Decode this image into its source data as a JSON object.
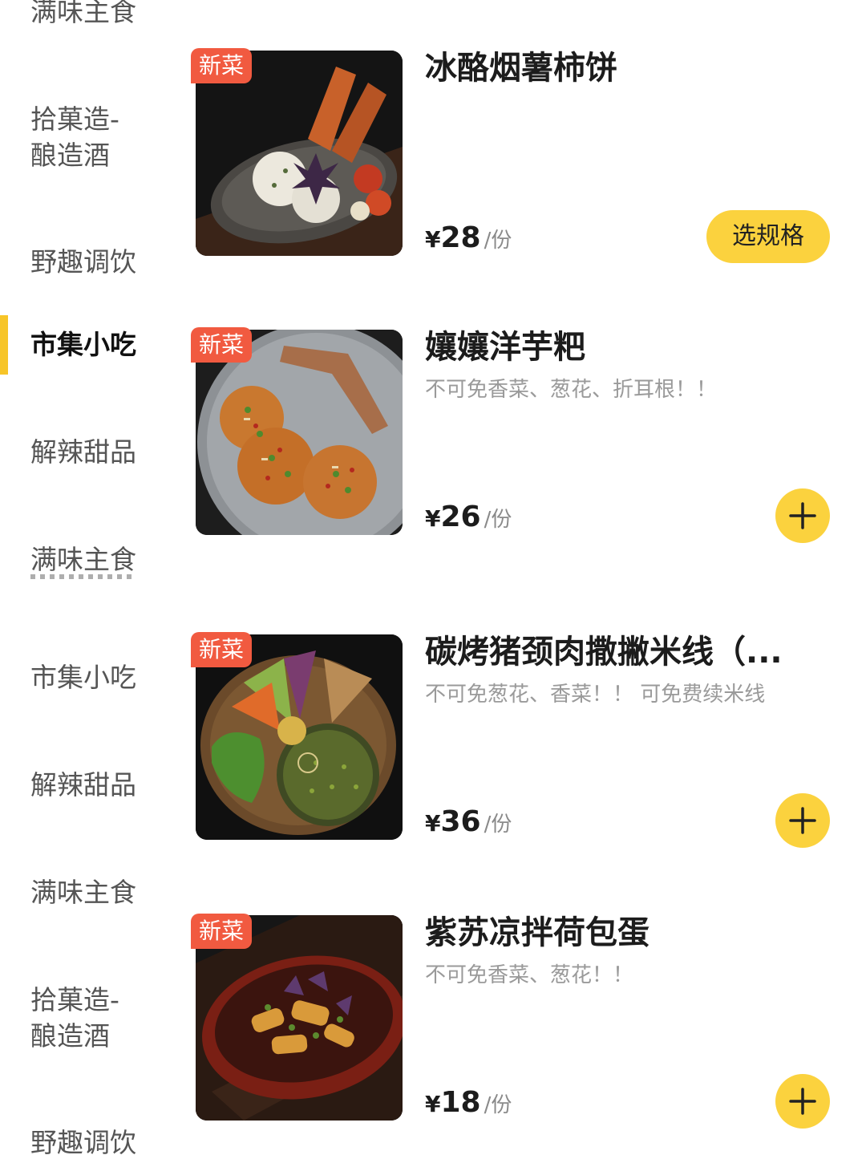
{
  "categories_top": [
    {
      "label": "满味主食"
    },
    {
      "label": "拾菓造-"
    },
    {
      "label": "酿造酒"
    },
    {
      "label": "野趣调饮"
    },
    {
      "label": "市集小吃"
    },
    {
      "label": "解辣甜品"
    },
    {
      "label": "满味主食"
    }
  ],
  "categories_bottom": [
    {
      "label": "市集小吃"
    },
    {
      "label": "解辣甜品"
    },
    {
      "label": "满味主食"
    },
    {
      "label": "拾菓造-"
    },
    {
      "label": "酿造酒"
    },
    {
      "label": "野趣调饮"
    }
  ],
  "accent_color": "#fbd23e",
  "badge_color": "#f15a40",
  "dishes": [
    {
      "badge": "新菜",
      "name": "冰酪烟薯柿饼",
      "desc": "",
      "currency": "¥",
      "price": "28",
      "unit": "/份",
      "action": "选规格"
    },
    {
      "badge": "新菜",
      "name": "孃孃洋芋粑",
      "desc": "不可免香菜、葱花、折耳根！！",
      "currency": "¥",
      "price": "26",
      "unit": "/份",
      "action": "plus-icon"
    },
    {
      "badge": "新菜",
      "name": "碳烤猪颈肉撒撇米线（...",
      "desc": "不可免葱花、香菜！！ 可免费续米线",
      "currency": "¥",
      "price": "36",
      "unit": "/份",
      "action": "plus-icon"
    },
    {
      "badge": "新菜",
      "name": "紫苏凉拌荷包蛋",
      "desc": "不可免香菜、葱花！！",
      "currency": "¥",
      "price": "18",
      "unit": "/份",
      "action": "plus-icon"
    }
  ]
}
